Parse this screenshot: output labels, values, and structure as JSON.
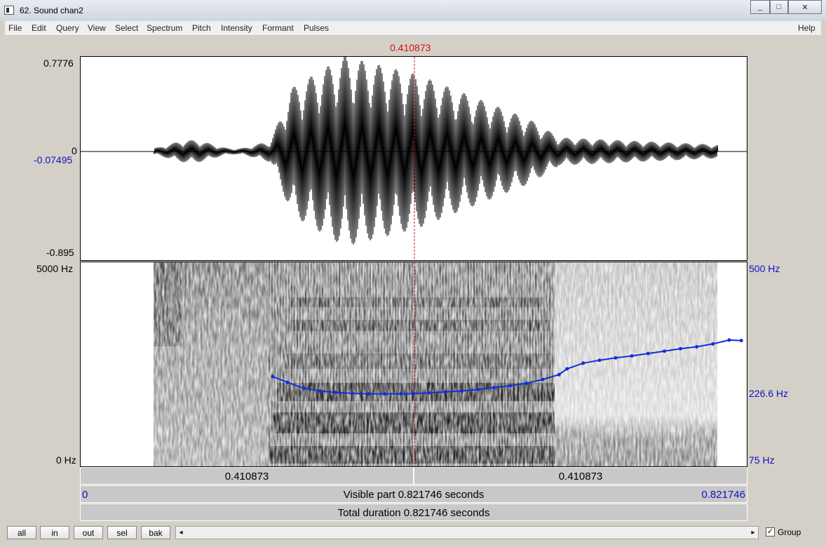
{
  "window": {
    "title": "62. Sound chan2",
    "min": "_",
    "max": "□",
    "close": "✕"
  },
  "menu": [
    "File",
    "Edit",
    "Query",
    "View",
    "Select",
    "Spectrum",
    "Pitch",
    "Intensity",
    "Formant",
    "Pulses"
  ],
  "help": "Help",
  "cursor": {
    "time_label": "0.410873",
    "time": 0.410873
  },
  "waveform": {
    "max_label": "0.7776",
    "zero_label": "0",
    "cursor_value_label": "-0.07495",
    "min_label": "-0.895"
  },
  "spectrogram": {
    "top_label": "5000 Hz",
    "bottom_label": "0 Hz"
  },
  "pitch": {
    "top_label": "500 Hz",
    "cursor_label": "226.6 Hz",
    "bottom_label": "75 Hz",
    "min_hz": 75,
    "max_hz": 500,
    "color": "#1030d8"
  },
  "time_bar": {
    "left_label": "0.410873",
    "right_label": "0.410873"
  },
  "visible_bar": {
    "start": "0",
    "text": "Visible part 0.821746 seconds",
    "end": "0.821746"
  },
  "total_bar": {
    "text": "Total duration 0.821746 seconds"
  },
  "nav_buttons": [
    "all",
    "in",
    "out",
    "sel",
    "bak"
  ],
  "scroll": {
    "left": "◂",
    "right": "▸"
  },
  "group": {
    "checked": true,
    "mark": "✓",
    "label": "Group"
  },
  "chart_data": {
    "type": "line",
    "x_unit": "s",
    "xlim": [
      0,
      0.821746
    ],
    "ylim": [
      75,
      500
    ],
    "series": [
      {
        "x": [
          0.237,
          0.255,
          0.275,
          0.295,
          0.315,
          0.335,
          0.355,
          0.375,
          0.395,
          0.411,
          0.43,
          0.45,
          0.47,
          0.49,
          0.51,
          0.53,
          0.55,
          0.57,
          0.59,
          0.6,
          0.62,
          0.64,
          0.66,
          0.68,
          0.7,
          0.72,
          0.74,
          0.76,
          0.78,
          0.8,
          0.815
        ],
        "y": [
          262,
          250,
          238,
          232,
          229,
          227,
          226,
          226,
          226,
          226.6,
          228,
          230,
          232,
          235,
          239,
          243,
          248,
          256,
          266,
          278,
          290,
          296,
          301,
          305,
          310,
          315,
          320,
          324,
          330,
          338,
          337
        ]
      }
    ]
  }
}
